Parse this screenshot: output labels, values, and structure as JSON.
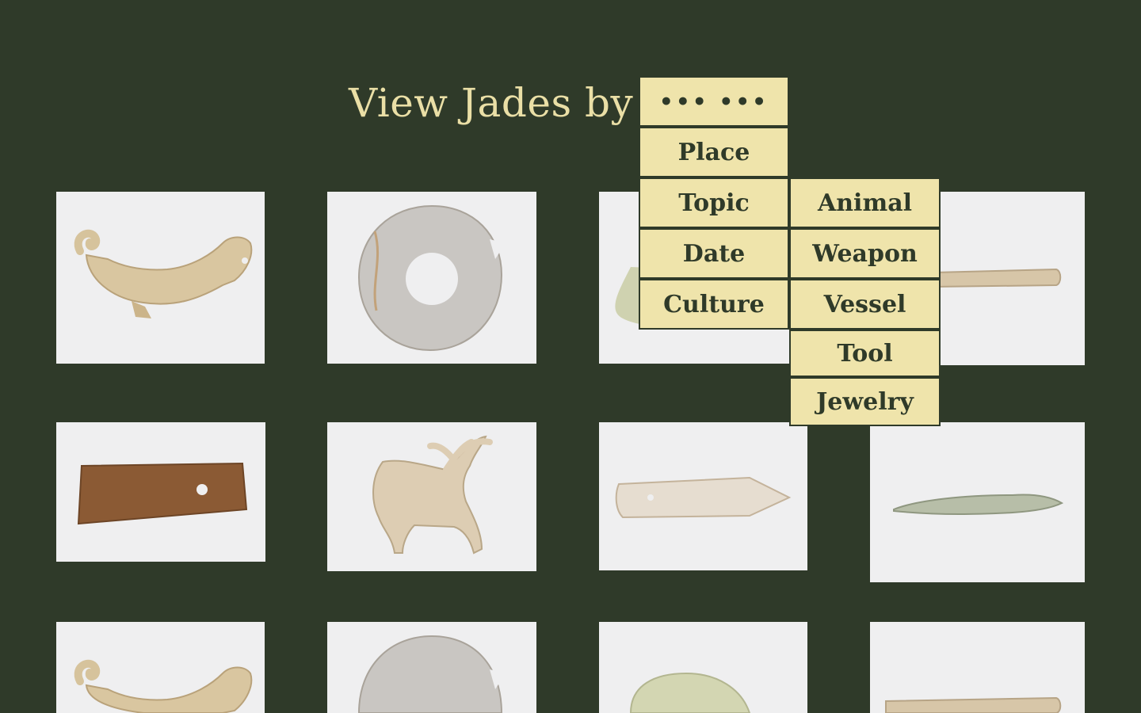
{
  "header": {
    "title": "View Jades by"
  },
  "menu": {
    "trigger_label": "••• •••",
    "primary": [
      "Place",
      "Topic",
      "Date",
      "Culture"
    ],
    "submenu": [
      "Animal",
      "Weapon",
      "Vessel",
      "Tool",
      "Jewelry"
    ]
  },
  "gallery": {
    "items": [
      {
        "subject": "dragon-pendant-icon"
      },
      {
        "subject": "notched-disc-icon"
      },
      {
        "subject": "jade-carving-icon"
      },
      {
        "subject": "awl-tool-icon"
      },
      {
        "subject": "perforated-plaque-icon"
      },
      {
        "subject": "deer-figure-icon"
      },
      {
        "subject": "blade-icon"
      },
      {
        "subject": "fish-figure-icon"
      },
      {
        "subject": "dragon-pendant-icon"
      },
      {
        "subject": "notched-disc-icon"
      },
      {
        "subject": "jade-carving-icon"
      },
      {
        "subject": "awl-tool-icon"
      }
    ]
  },
  "colors": {
    "background": "#2f3a29",
    "title": "#eadfa6",
    "menu_fill": "#efe4ab",
    "menu_text": "#2f3a29",
    "tile_background": "#efeff0"
  }
}
